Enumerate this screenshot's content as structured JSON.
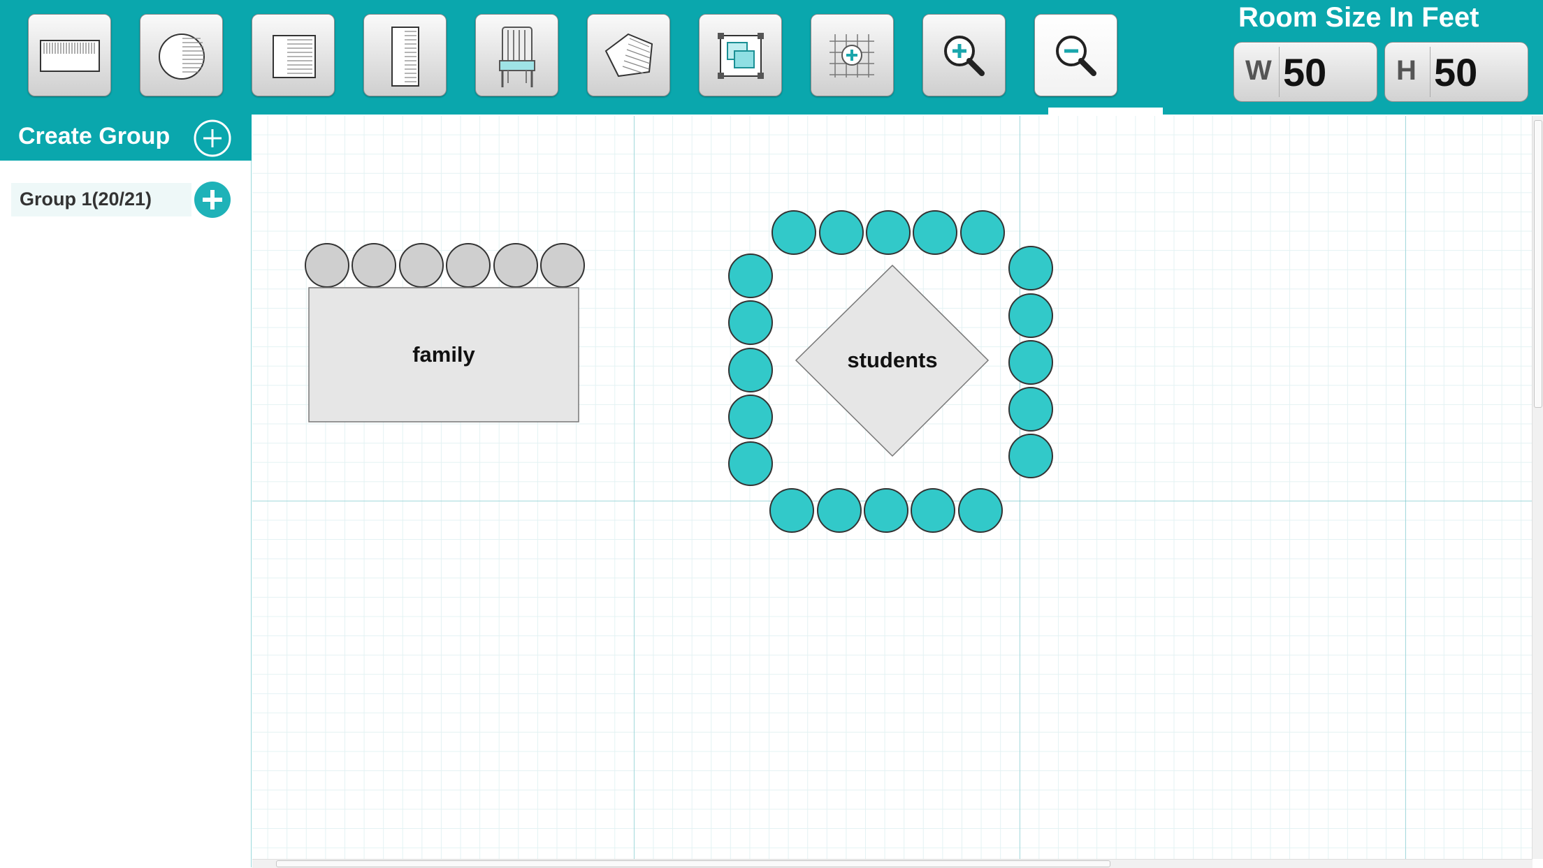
{
  "toolbar": {
    "tools": [
      {
        "name": "rectangle-table-tool",
        "icon": "rect-table-icon"
      },
      {
        "name": "round-table-tool",
        "icon": "round-table-icon"
      },
      {
        "name": "square-table-tool",
        "icon": "square-table-icon"
      },
      {
        "name": "long-table-tool",
        "icon": "long-table-icon"
      },
      {
        "name": "chair-tool",
        "icon": "chair-icon"
      },
      {
        "name": "polygon-table-tool",
        "icon": "pentagon-table-icon"
      },
      {
        "name": "fit-to-screen-tool",
        "icon": "fit-screen-icon"
      },
      {
        "name": "grid-add-tool",
        "icon": "grid-add-icon"
      },
      {
        "name": "zoom-in-tool",
        "icon": "zoom-in-icon"
      },
      {
        "name": "zoom-out-tool",
        "icon": "zoom-out-icon"
      }
    ]
  },
  "room_size": {
    "title": "Room Size In Feet",
    "width_label": "W",
    "width_value": "50",
    "height_label": "H",
    "height_value": "50"
  },
  "sidebar": {
    "create_group_label": "Create Group",
    "groups": [
      {
        "label": "Group 1(20/21)"
      }
    ]
  },
  "canvas": {
    "tables": [
      {
        "name": "family",
        "label": "family",
        "shape": "rectangle",
        "seat_count": 6,
        "seat_color": "#cfcfcf"
      },
      {
        "name": "students",
        "label": "students",
        "shape": "diamond",
        "seat_count": 20,
        "seat_color": "#32c9c9"
      }
    ]
  },
  "colors": {
    "accent": "#0aa7ad",
    "seat_filled": "#32c9c9",
    "seat_empty": "#cfcfcf",
    "table_fill": "#e6e6e6"
  }
}
